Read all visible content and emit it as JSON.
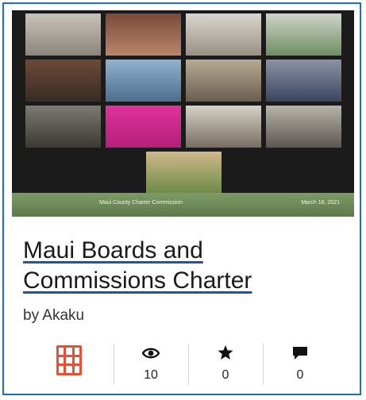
{
  "card": {
    "title_line1": "Maui Boards and",
    "title_line2": "Commissions Charter",
    "byline": "by Akaku",
    "thumbnail": {
      "footer_left": "Maui County Charter Commission",
      "footer_right": "March 18, 2021",
      "participants": [
        "",
        "",
        "",
        "",
        "",
        "",
        "",
        "",
        "",
        "",
        "",
        "",
        "",
        "",
        "",
        ""
      ]
    },
    "stats": {
      "type_icon": "film-icon",
      "views_icon": "eye-icon",
      "views": "10",
      "favorites_icon": "star-icon",
      "favorites": "0",
      "comments_icon": "comment-icon",
      "comments": "0"
    },
    "colors": {
      "border": "#1f6fbf",
      "film": "#e0523a",
      "link": "#1a56a8"
    }
  }
}
